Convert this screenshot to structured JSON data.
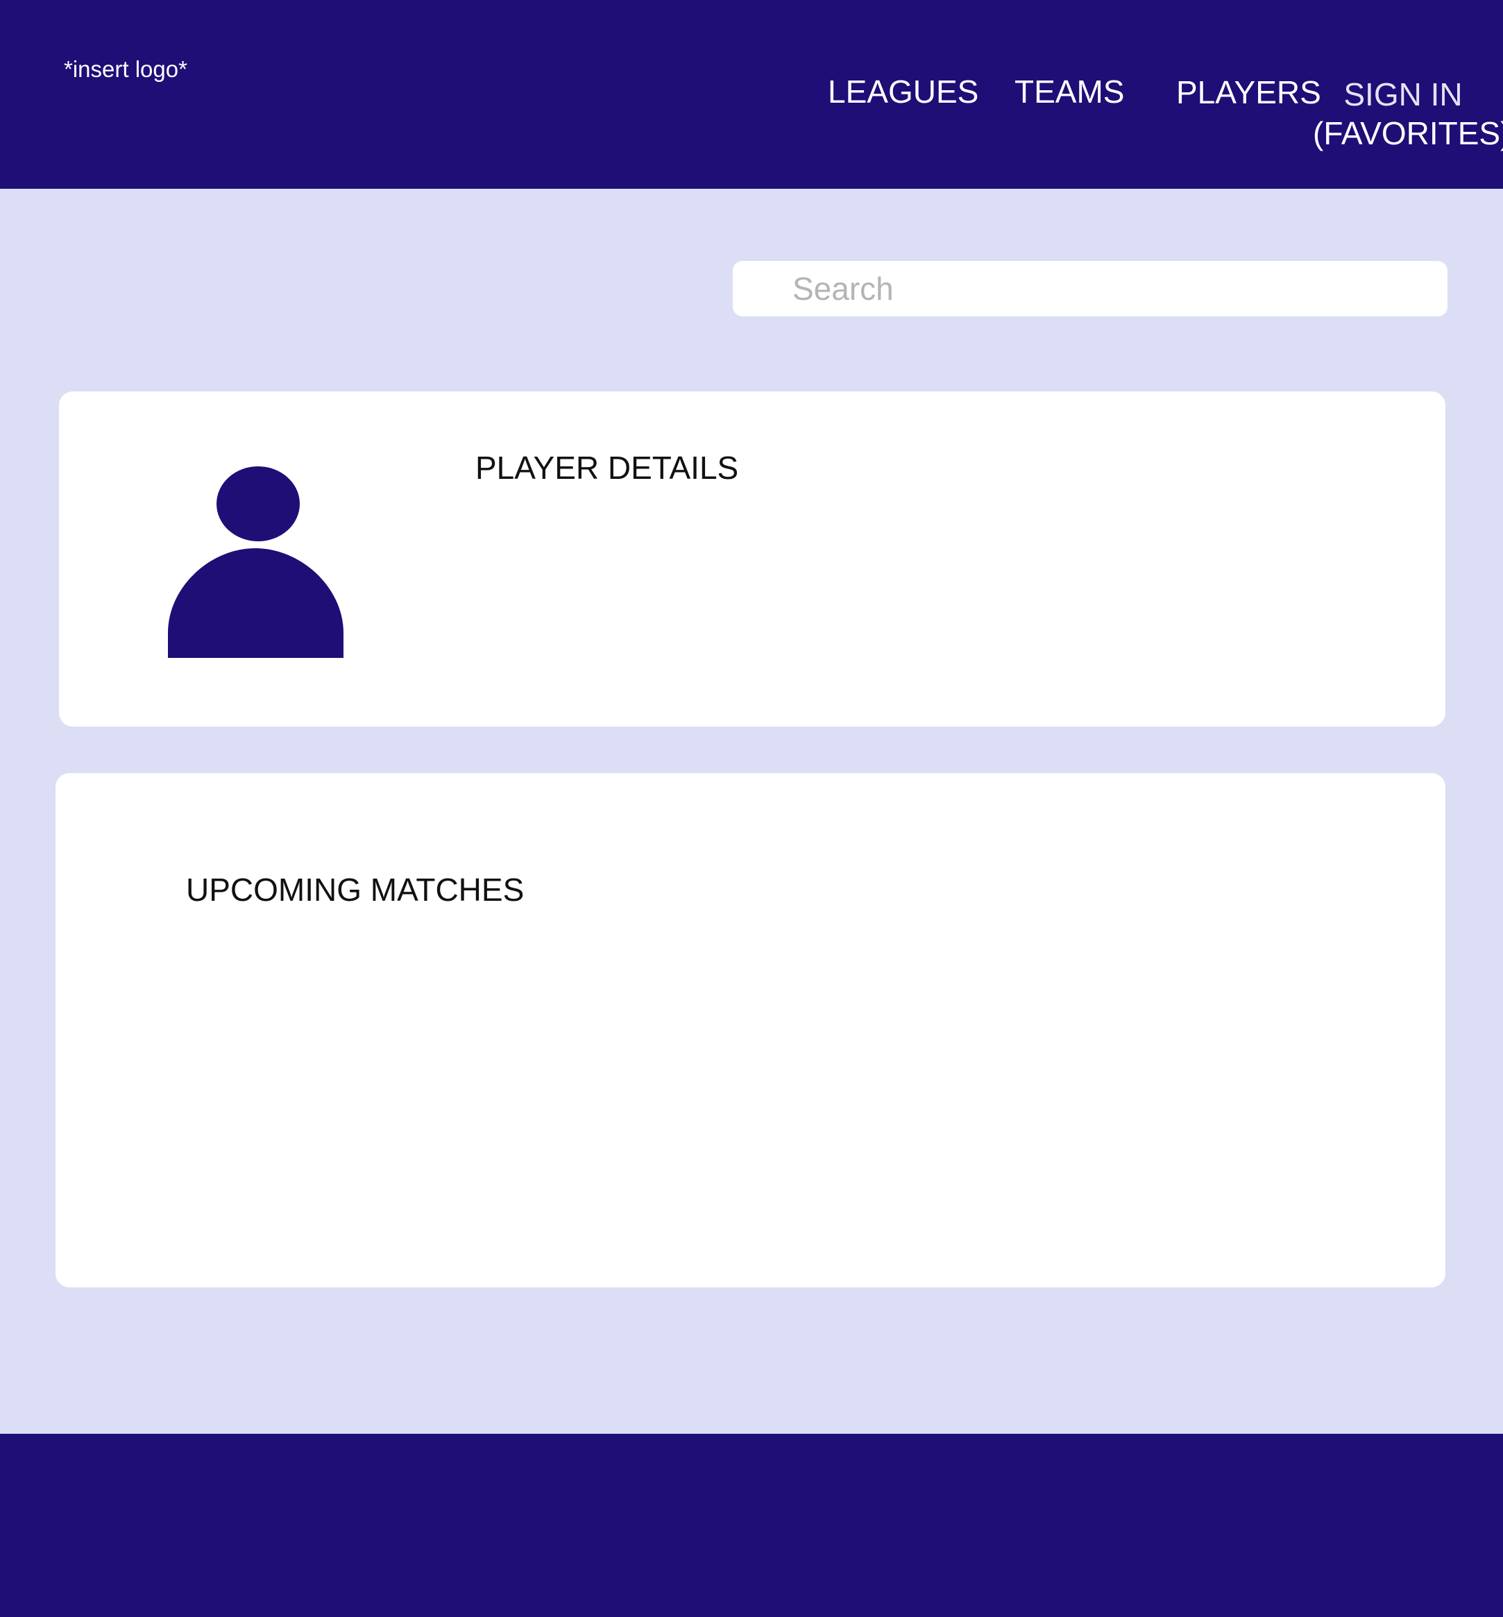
{
  "header": {
    "logo_text": "*insert logo*",
    "nav": {
      "leagues": "LEAGUES",
      "teams": "TEAMS",
      "players": "PLAYERS",
      "sign_in": "SIGN IN",
      "sign_in_sub": "(FAVORITES)"
    }
  },
  "search": {
    "placeholder": "Search",
    "value": ""
  },
  "player_card": {
    "title": "PLAYER DETAILS",
    "avatar_icon": "user-avatar-icon"
  },
  "matches_card": {
    "title": "UPCOMING MATCHES"
  },
  "colors": {
    "primary": "#1E0E76",
    "background": "#DCDEF5",
    "card": "#FFFFFF",
    "placeholder": "#B4B4B4"
  }
}
